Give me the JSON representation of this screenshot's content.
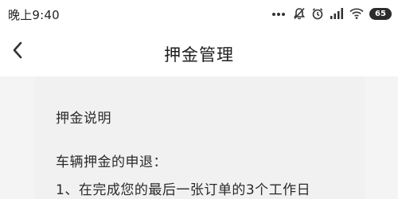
{
  "status_bar": {
    "time": "晚上9:40",
    "icons": [
      "more-dots-icon",
      "mute-icon",
      "alarm-icon",
      "signal-icon",
      "wifi-icon",
      "battery-icon"
    ],
    "battery_level": "65"
  },
  "nav": {
    "back_icon": "chevron-left-icon",
    "title": "押金管理"
  },
  "content": {
    "section_title": "押金说明",
    "refund_heading": "车辆押金的申退：",
    "rule_1": "1、在完成您的最后一张订单的3个工作日"
  }
}
